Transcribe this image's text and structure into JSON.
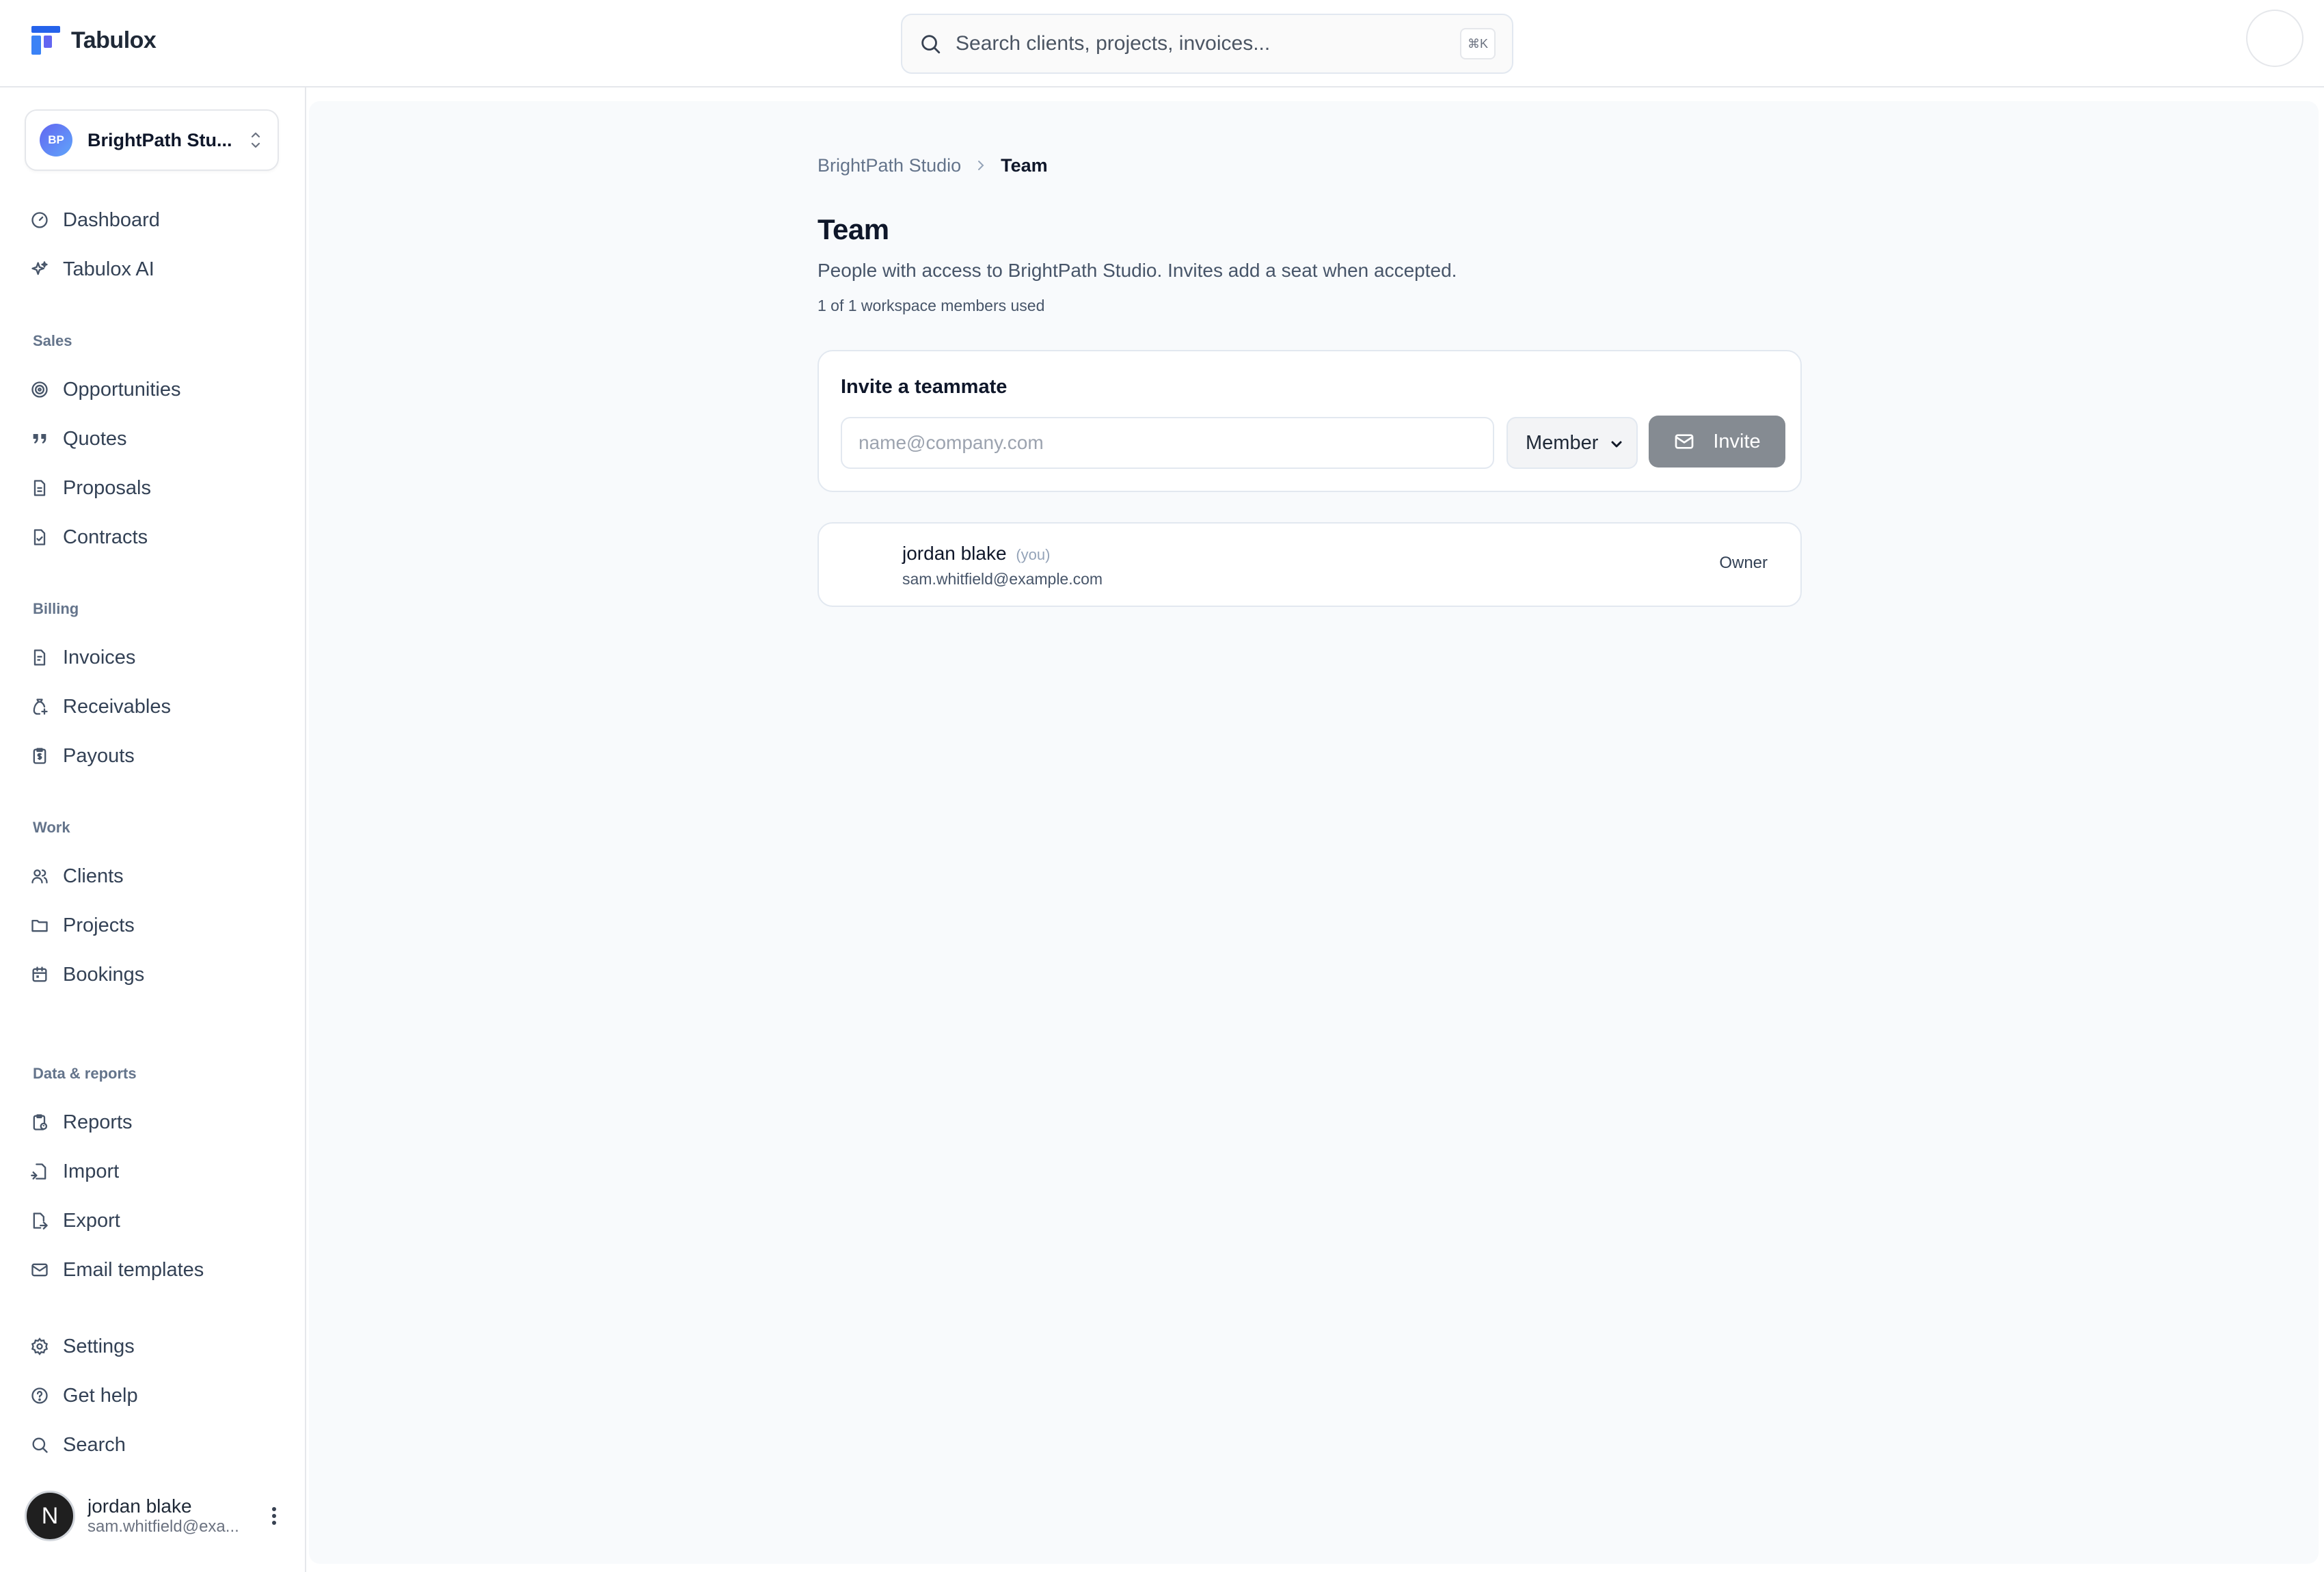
{
  "app": {
    "name": "Tabulox"
  },
  "search": {
    "placeholder": "Search clients, projects, invoices...",
    "shortcut": "⌘K"
  },
  "workspace": {
    "initials": "BP",
    "name": "BrightPath Stu..."
  },
  "sidebar": {
    "top_items": [
      {
        "label": "Dashboard",
        "icon": "dashboard-icon"
      },
      {
        "label": "Tabulox AI",
        "icon": "sparkles-icon"
      }
    ],
    "sections": [
      {
        "title": "Sales",
        "items": [
          {
            "label": "Opportunities",
            "icon": "target-icon"
          },
          {
            "label": "Quotes",
            "icon": "quote-icon"
          },
          {
            "label": "Proposals",
            "icon": "document-icon"
          },
          {
            "label": "Contracts",
            "icon": "document-check-icon"
          }
        ]
      },
      {
        "title": "Billing",
        "items": [
          {
            "label": "Invoices",
            "icon": "invoice-icon"
          },
          {
            "label": "Receivables",
            "icon": "receivables-icon"
          },
          {
            "label": "Payouts",
            "icon": "payout-icon"
          }
        ]
      },
      {
        "title": "Work",
        "items": [
          {
            "label": "Clients",
            "icon": "users-icon"
          },
          {
            "label": "Projects",
            "icon": "folder-icon"
          },
          {
            "label": "Bookings",
            "icon": "calendar-icon"
          }
        ]
      },
      {
        "title": "Data & reports",
        "items": [
          {
            "label": "Reports",
            "icon": "reports-icon"
          },
          {
            "label": "Import",
            "icon": "import-icon"
          },
          {
            "label": "Export",
            "icon": "export-icon"
          },
          {
            "label": "Email templates",
            "icon": "mail-icon"
          }
        ]
      }
    ],
    "bottom_items": [
      {
        "label": "Settings",
        "icon": "gear-icon"
      },
      {
        "label": "Get help",
        "icon": "help-icon"
      },
      {
        "label": "Search",
        "icon": "search-icon"
      }
    ]
  },
  "user": {
    "avatar_letter": "N",
    "name": "jordan blake",
    "email": "sam.whitfield@exa..."
  },
  "breadcrumb": {
    "parent": "BrightPath Studio",
    "current": "Team"
  },
  "page": {
    "title": "Team",
    "description": "People with access to BrightPath Studio. Invites add a seat when accepted.",
    "seats": "1 of 1 workspace members used"
  },
  "invite": {
    "title": "Invite a teammate",
    "email_placeholder": "name@company.com",
    "role_value": "Member",
    "button_label": "Invite"
  },
  "members": [
    {
      "name": "jordan blake",
      "you_tag": "(you)",
      "email": "sam.whitfield@example.com",
      "role": "Owner"
    }
  ],
  "colors": {
    "accent_gradient_start": "#6366f1",
    "accent_gradient_end": "#60a5fa",
    "invite_button": "#858b92",
    "main_background": "#f8fafc"
  }
}
